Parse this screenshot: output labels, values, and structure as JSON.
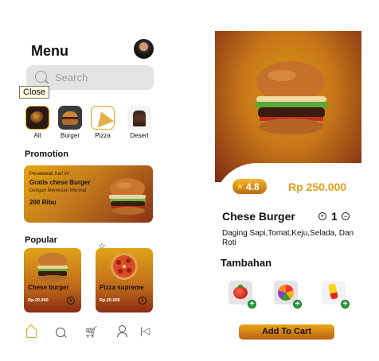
{
  "left": {
    "title": "Menu",
    "search": {
      "placeholder": "Search"
    },
    "tooltip": "Close",
    "categories": [
      {
        "label": "All",
        "icon": "all-food-icon"
      },
      {
        "label": "Burger",
        "icon": "burger-icon"
      },
      {
        "label": "Pizza",
        "icon": "pizza-icon"
      },
      {
        "label": "Desert",
        "icon": "desert-icon"
      }
    ],
    "promotion": {
      "section_title": "Promotion",
      "line1": "Penawaran hari ini",
      "line2": "Gratis chese Burger",
      "line3": "Dengan Memesan Minimal",
      "line4": "200 Ribu"
    },
    "popular": {
      "section_title": "Popular",
      "items": [
        {
          "name": "Chese burger",
          "price": "Rp.20.000"
        },
        {
          "name": "Pizza supreme",
          "price": "Rp.20.000"
        }
      ]
    },
    "nav": [
      "home-icon",
      "search-icon",
      "cart-icon",
      "user-icon",
      "back-icon"
    ]
  },
  "right": {
    "rating": "4.8",
    "price": "Rp 250.000",
    "product_name": "Chese Burger",
    "quantity": "1",
    "description": "Daging Sapi,Tomat,Keju,Selada, Dan Roti",
    "extras_title": "Tambahan",
    "extras": [
      "tomato-icon",
      "vegetables-icon",
      "sauce-icon"
    ],
    "add_to_cart": "Add To Cart"
  },
  "colors": {
    "accent": "#e39d18",
    "accent_dark": "#7c2a14",
    "add_green": "#29a23a"
  }
}
